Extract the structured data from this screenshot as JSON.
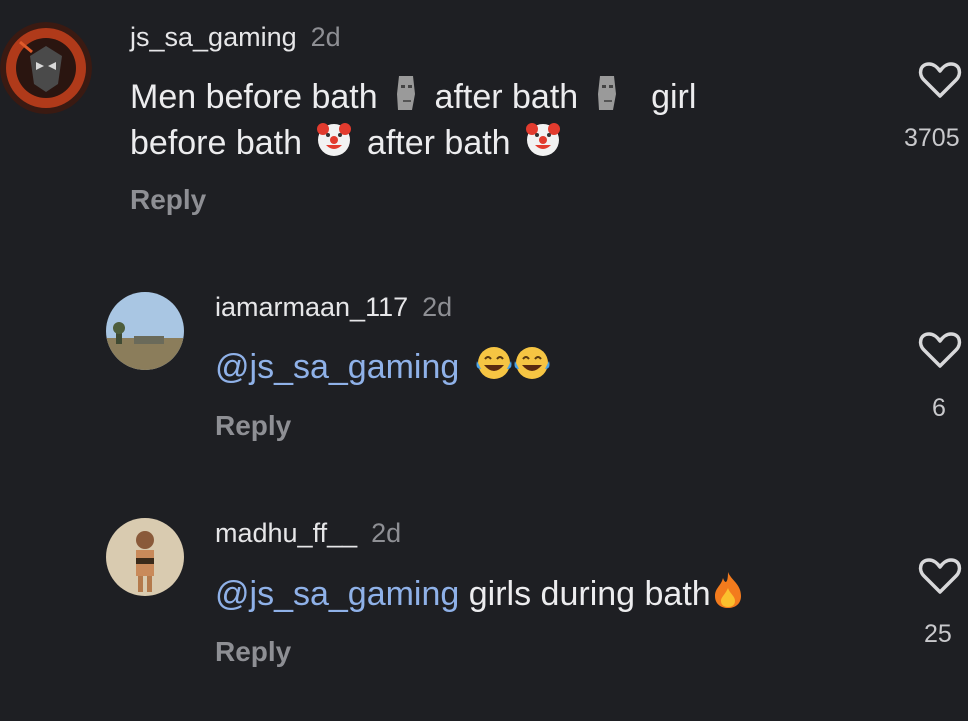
{
  "comments": [
    {
      "username": "js_sa_gaming",
      "time": "2d",
      "text_parts": [
        "Men  before bath",
        "after bath",
        "girl",
        "before bath",
        "after bath"
      ],
      "reply": "Reply",
      "likes": "3705",
      "icons": [
        "moai-emoji-icon",
        "clown-emoji-icon",
        "heart-icon"
      ]
    },
    {
      "username": "iamarmaan_117",
      "time": "2d",
      "mention": "@js_sa_gaming",
      "reply": "Reply",
      "likes": "6",
      "icons": [
        "laughing-tears-emoji-icon",
        "heart-icon"
      ]
    },
    {
      "username": "madhu_ff__",
      "time": "2d",
      "mention": "@js_sa_gaming",
      "text": "girls during bath",
      "reply": "Reply",
      "likes": "25",
      "icons": [
        "fire-emoji-icon",
        "heart-icon"
      ]
    }
  ],
  "colors": {
    "background": "#1e1f23",
    "mention": "#8fb1e8",
    "secondary_text": "#8e8f94"
  }
}
